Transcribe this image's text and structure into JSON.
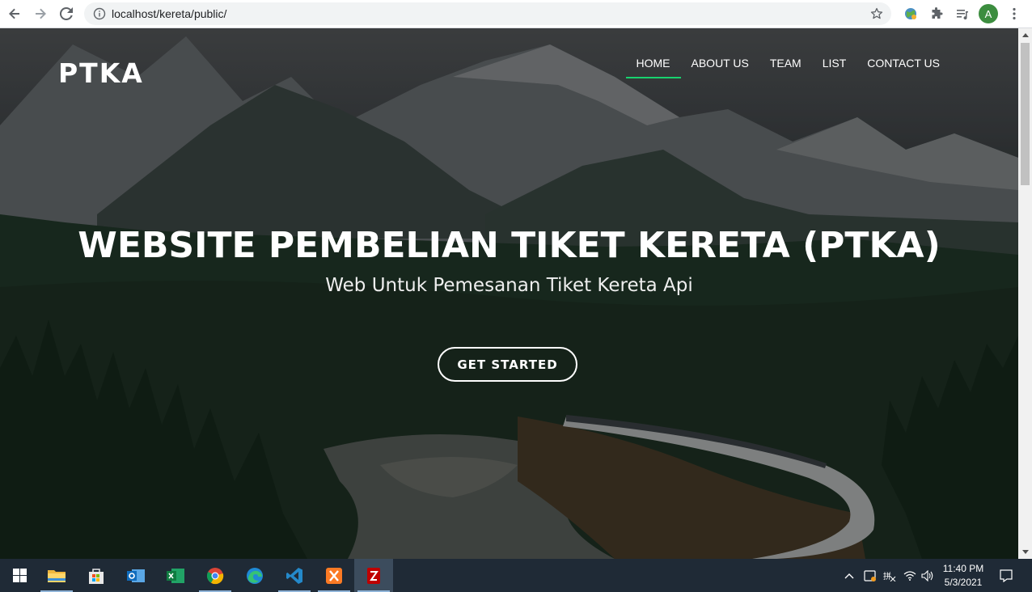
{
  "browser": {
    "url": "localhost/kereta/public/",
    "profile_initial": "A"
  },
  "site": {
    "brand": "PTKA",
    "nav": [
      {
        "label": "HOME",
        "active": true
      },
      {
        "label": "ABOUT US",
        "active": false
      },
      {
        "label": "TEAM",
        "active": false
      },
      {
        "label": "LIST",
        "active": false
      },
      {
        "label": "CONTACT US",
        "active": false
      }
    ],
    "hero": {
      "title": "WEBSITE PEMBELIAN TIKET KERETA (PTKA)",
      "subtitle": "Web Untuk Pemesanan Tiket Kereta Api",
      "cta": "GET STARTED"
    },
    "accent_color": "#18d26e"
  },
  "taskbar": {
    "apps": [
      "windows-start",
      "file-explorer",
      "microsoft-store",
      "outlook",
      "excel",
      "chrome",
      "edge",
      "vscode",
      "xampp",
      "filezilla"
    ],
    "time": "11:40 PM",
    "date": "5/3/2021"
  }
}
